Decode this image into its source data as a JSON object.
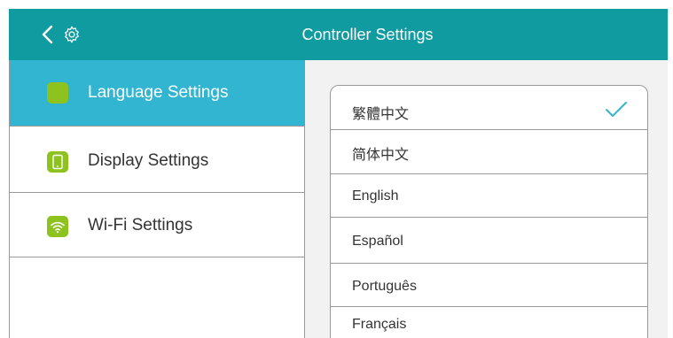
{
  "header": {
    "title": "Controller Settings",
    "back_icon": "chevron-left-icon",
    "settings_icon": "gear-icon"
  },
  "sidebar": {
    "items": [
      {
        "label": "Language Settings",
        "icon": "language-icon",
        "active": true
      },
      {
        "label": "Display Settings",
        "icon": "tablet-icon",
        "active": false
      },
      {
        "label": "Wi-Fi Settings",
        "icon": "wifi-icon",
        "active": false
      }
    ]
  },
  "languages": {
    "items": [
      {
        "label": "繁體中文",
        "selected": true
      },
      {
        "label": "简体中文",
        "selected": false
      },
      {
        "label": "English",
        "selected": false
      },
      {
        "label": "Español",
        "selected": false
      },
      {
        "label": "Português",
        "selected": false
      },
      {
        "label": "Français",
        "selected": false
      }
    ]
  },
  "colors": {
    "header_bg": "#0f9ba0",
    "active_bg": "#31b5d0",
    "icon_green": "#8dc21f",
    "check_blue": "#31b5d0"
  }
}
